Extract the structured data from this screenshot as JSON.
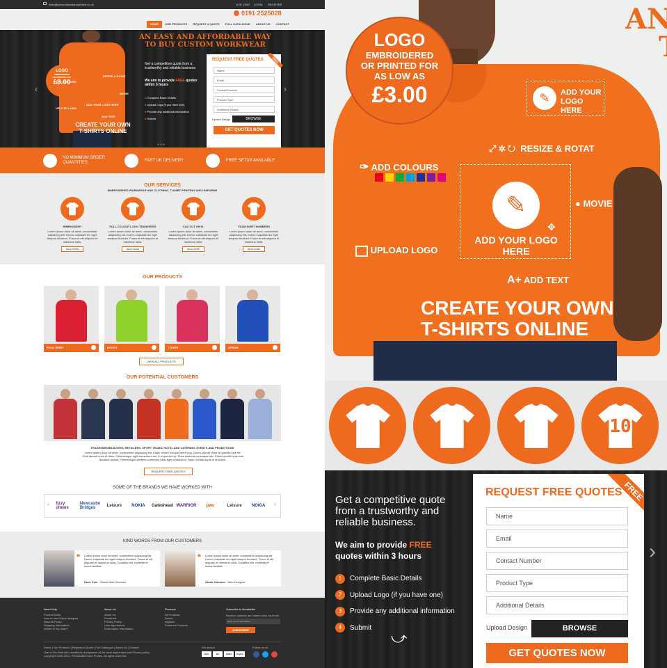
{
  "topbar": {
    "email": "hello@personalisedandprinted.co.uk",
    "live_chat": "LIVE CHAT",
    "login": "LOGIN",
    "register": "REGISTER",
    "phone": "0191 2525028"
  },
  "nav": {
    "items": [
      "HOME",
      "OUR PRODUCTS",
      "REQUEST A QUOTE",
      "FULL CATALOGUE",
      "ABOUT US",
      "CONTACT"
    ]
  },
  "hero": {
    "headline_1": "AN EASY AND AFFORDABLE WAY",
    "headline_2": "TO BUY CUSTOM WORKWEAR",
    "logo_badge": {
      "title": "LOGO",
      "line1": "EMBROIDERED",
      "line2": "OR PRINTED FOR",
      "line3": "AS LOW AS",
      "price": "£3.00"
    },
    "add_your_logo": "ADD YOUR LOGO HERE",
    "resize": "RESIZE & ROTAT",
    "add_colours": "ADD COLOURS",
    "movie": "MOVIE",
    "upload_logo": "UPLOAD LOGO",
    "add_text": "ADD TEXT",
    "create_1": "CREATE YOUR OWN",
    "create_2": "T-SHIRTS ONLINE",
    "intro": "Get a competitive quote from a trustworthy and reliable business.",
    "aim_1": "We aim to provide",
    "aim_free": "FREE",
    "aim_2": "quotes within 3 hours",
    "steps": [
      "Complete Basic Details",
      "Upload Logo (if you have one)",
      "Provide any additional information",
      "Submit"
    ],
    "swatches": [
      "#e8001c",
      "#ffd200",
      "#00b140",
      "#00a3e0",
      "#1f2ea1",
      "#7a1fa2",
      "#e4007c"
    ]
  },
  "quote_form": {
    "title": "REQUEST FREE QUOTES",
    "ribbon": "FREE",
    "fields": [
      "Name",
      "Email",
      "Contact Number",
      "Product Type",
      "Additional Details"
    ],
    "upload_label": "Upload Design",
    "browse": "BROWSE",
    "submit": "GET QUOTES NOW"
  },
  "features": [
    "NO MINIMUM ORDER QUANTITIES",
    "FAST UK DELIVERY",
    "FREE SETUP AVAILABLE"
  ],
  "services": {
    "title": "OUR SERVICES",
    "subtitle": "EMBROIDERED WORKWEAR AND CLOTHING, T-SHIRT PRINTING AND UNIFORMS",
    "items": [
      {
        "name": "EMBROIDERY"
      },
      {
        "name": "FULL COLOUR LOGO TRANSFERS"
      },
      {
        "name": "CAD CUT VINYL"
      },
      {
        "name": "TEAM SHIRT NUMBERS"
      }
    ],
    "body": "Lorem ipsum dolor sit amet, consectetur adipiscing elit. Donec vulputate leo eget tempus tincidunt. Fusce et elit aliquam et maximus nulla.",
    "read_more": "READ MORE",
    "number": "10"
  },
  "products": {
    "title": "OUR PRODUCTS",
    "items": [
      {
        "name": "POLO SHIRT",
        "color": "#d92030"
      },
      {
        "name": "HOODY",
        "color": "#8ed12a"
      },
      {
        "name": "T SHIRT",
        "color": "#d8315c"
      },
      {
        "name": "APRON",
        "color": "#2050b8"
      }
    ],
    "view_all": "VIEW ALL PRODUCTS"
  },
  "customers": {
    "title": "OUR POTENTIAL CUSTOMERS",
    "subtitle": "TRADESMEN/BUILDERS, RETAILERS, SPORT TEAMS, HOTEL AND CATERING, EVENTS AND PROMOTIONS",
    "body": "Lorem ipsum dolor sit amet, consectetur adipiscing elit. Etiam ornare congue libero non. Donec rutrum dolor sit gravida sed elit. Cras laoreet enim et diam. Pellentesque eget fermentum dui, in imperdiet mi. Nunc eleifend consequat nisi. Etiam lobortis quis erat tincidunt lacinia. Pellentesque eleifend commodo risus eget vestibulum. Nunc ut vitae ligula ut tincidunt.",
    "cta": "REQUEST FREE QUOTES",
    "figure_colors": [
      "#c4323a",
      "#2a3550",
      "#24304a",
      "#c43226",
      "#ee6a1f",
      "#2a58c8",
      "#1c2440",
      "#9ab0d8"
    ]
  },
  "brands": {
    "title": "SOME OF THE BRANDS WE HAVE WORKED WITH",
    "items": [
      "fizzy chews",
      "Newcastle Bridges",
      "Leisure",
      "NOKIA",
      "Gateshead",
      "WARRIOR",
      "pwc",
      "Leisure",
      "NOKIA"
    ]
  },
  "testimonials": {
    "title": "KIND WORDS FROM OUR CUSTOMERS",
    "items": [
      {
        "text": "Lorem ipsum dolor sit amet, consectetur adipiscing elit. Donec vulputate leo eget tempus tincidunt. Fusce et elit aliquam et maximus nulla. Curabitur elit, molestie et luctus facilisis.",
        "author": "Dave Cole",
        "role": "- Global Web Services"
      },
      {
        "text": "Lorem ipsum dolor sit amet, consectetur adipiscing elit. Donec vulputate leo eget tempus tincidunt. Fusce et elit aliquam et maximus nulla. Curabitur elit, molestie et luctus facilisis.",
        "author": "Sarah Johnson",
        "role": "- Web Designer"
      }
    ]
  },
  "footer": {
    "cols": [
      {
        "title": "Need Help",
        "links": [
          "Product Index",
          "How to use Online designer",
          "Returns Policy",
          "Shipping Information",
          "Where is my order?"
        ]
      },
      {
        "title": "About Us",
        "links": [
          "About Us",
          "Feedback",
          "Privacy Policy",
          "User Agreement",
          "Embroidery Information"
        ]
      },
      {
        "title": "Products",
        "links": [
          "All Products",
          "Sector",
          "Apparel",
          "Featured Products"
        ]
      }
    ],
    "newsletter_title": "Subscribe to Newsletter",
    "newsletter_text": "Receive updates and latest news via email.",
    "email_placeholder": "Enter your email address",
    "subscribe": "SUBSCRIBE",
    "bottom_links": "Home | Our Products | Request a Quote | Full Catalogue | About Us | Contact",
    "copyright_1": "Use of this Web site constitutes acceptance of the User Agreement and Privacy policy.",
    "copyright_2": "Copyright 2000-2014, Personalised and Printed. All rights reserved.",
    "we_accept": "We accept",
    "follow": "Follow us on",
    "cards": [
      "VISA",
      "MC",
      "AMEX",
      "PayPal"
    ]
  },
  "zoom": {
    "partial_headline_1": "AN",
    "partial_headline_2": "T",
    "number": "10"
  }
}
